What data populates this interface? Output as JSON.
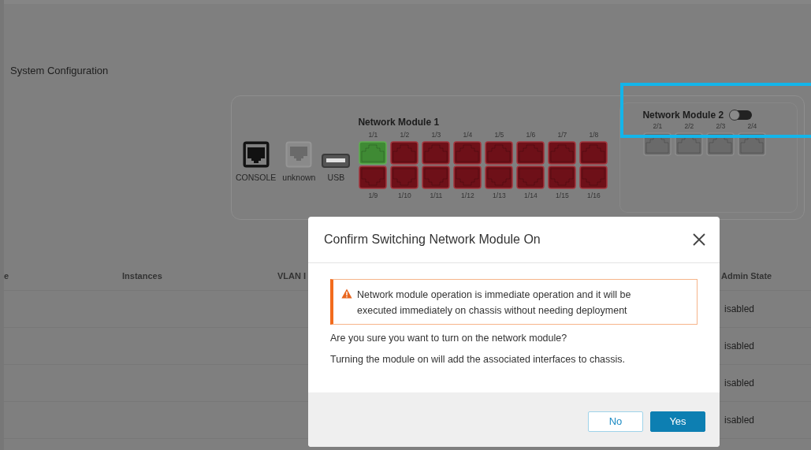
{
  "page": {
    "title": "System Configuration"
  },
  "fixed_ports": [
    {
      "kind": "console",
      "label": "CONSOLE"
    },
    {
      "kind": "rj45",
      "label": "unknown"
    },
    {
      "kind": "usb",
      "label": "USB"
    }
  ],
  "module_1": {
    "title": "Network Module 1",
    "top_row": [
      {
        "label": "1/1",
        "connected": true
      },
      {
        "label": "1/2",
        "connected": false
      },
      {
        "label": "1/3",
        "connected": false
      },
      {
        "label": "1/4",
        "connected": false
      },
      {
        "label": "1/5",
        "connected": false
      },
      {
        "label": "1/6",
        "connected": false
      },
      {
        "label": "1/7",
        "connected": false
      },
      {
        "label": "1/8",
        "connected": false
      }
    ],
    "bottom_row": [
      {
        "label": "1/9",
        "connected": false
      },
      {
        "label": "1/10",
        "connected": false
      },
      {
        "label": "1/11",
        "connected": false
      },
      {
        "label": "1/12",
        "connected": false
      },
      {
        "label": "1/13",
        "connected": false
      },
      {
        "label": "1/14",
        "connected": false
      },
      {
        "label": "1/15",
        "connected": false
      },
      {
        "label": "1/16",
        "connected": false
      }
    ]
  },
  "module_2": {
    "title": "Network Module 2",
    "switch": {
      "on": false
    },
    "ports": [
      {
        "label": "2/1"
      },
      {
        "label": "2/2"
      },
      {
        "label": "2/3"
      },
      {
        "label": "2/4"
      }
    ]
  },
  "table": {
    "columns": [
      "e",
      "Instances",
      "VLAN I",
      "Admin State"
    ],
    "rows": [
      {
        "admin_state": "isabled"
      },
      {
        "admin_state": "isabled"
      },
      {
        "admin_state": "isabled"
      },
      {
        "admin_state": "isabled"
      }
    ]
  },
  "dialog": {
    "title": "Confirm Switching Network Module On",
    "warning": "Network module operation is immediate operation and it will be executed immediately on chassis without needing deployment",
    "paragraphs": [
      "Are you sure you want to turn on the network module?",
      "Turning the module on will add the associated interfaces to chassis."
    ],
    "buttons": [
      {
        "label": "No",
        "kind": "secondary"
      },
      {
        "label": "Yes",
        "kind": "primary"
      }
    ]
  }
}
